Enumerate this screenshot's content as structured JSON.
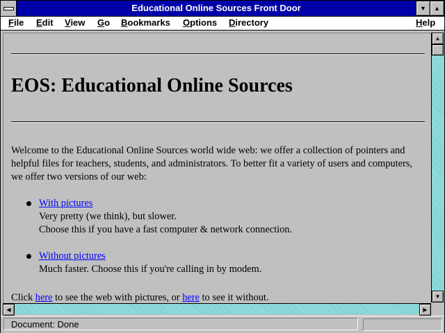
{
  "window": {
    "title": "Educational Online Sources Front Door"
  },
  "titlebar_buttons": {
    "minimize_glyph": "▼",
    "maximize_glyph": "▲"
  },
  "menus": [
    "File",
    "Edit",
    "View",
    "Go",
    "Bookmarks",
    "Options",
    "Directory",
    "Help"
  ],
  "page": {
    "heading": "EOS: Educational Online Sources",
    "intro": "Welcome to the Educational Online Sources world wide web: we offer a collection of pointers and helpful files for teachers, students, and administrators. To better fit a variety of users and computers, we offer two versions of our web:",
    "options": [
      {
        "link": "With pictures",
        "line1": "Very pretty (we think), but slower.",
        "line2": "Choose this if you have a fast computer & network connection."
      },
      {
        "link": "Without pictures",
        "line1": "Much faster. Choose this if you're calling in by modem."
      }
    ],
    "bottom": {
      "before": "Click ",
      "link1": "here",
      "middle": " to see the web with pictures, or ",
      "link2": "here",
      "after": " to see it without."
    }
  },
  "scrollbar": {
    "up": "▲",
    "down": "▼",
    "left": "◀",
    "right": "▶"
  },
  "status": {
    "text": "Document: Done"
  }
}
